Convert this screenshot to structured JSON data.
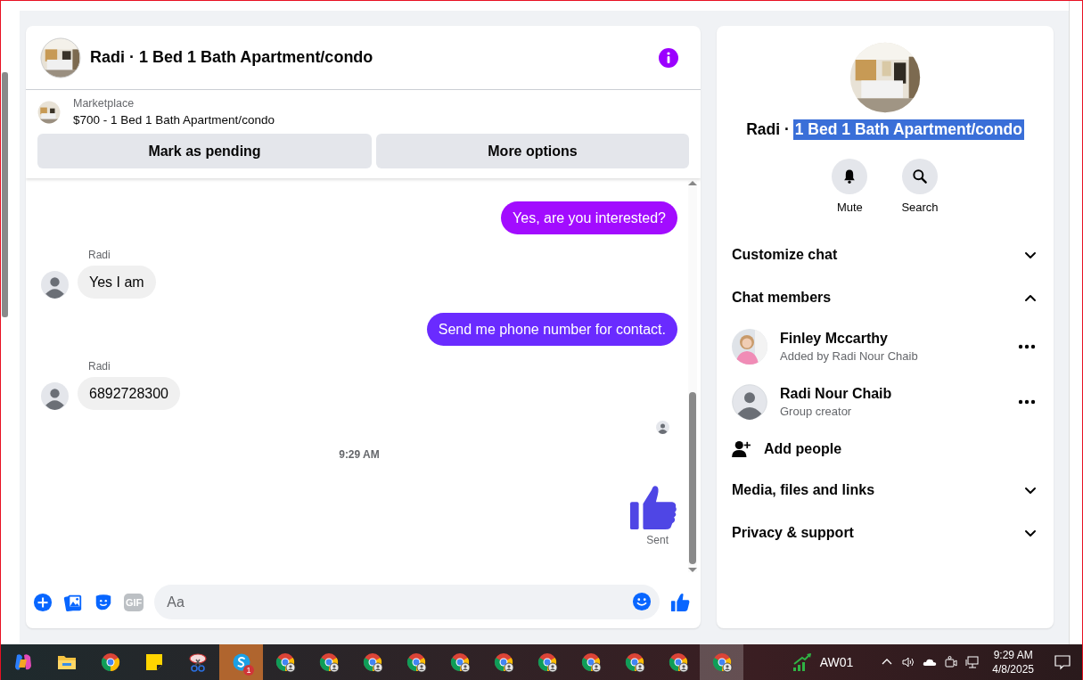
{
  "chat": {
    "title": "Radi · 1 Bed 1 Bath Apartment/condo",
    "listing": {
      "source": "Marketplace",
      "title": "$700 - 1 Bed 1 Bath Apartment/condo"
    },
    "actions": [
      "Mark as pending",
      "More options"
    ],
    "messages": [
      {
        "kind": "outgoing",
        "text": "Yes, are you interested?",
        "color": "#a20cff"
      },
      {
        "kind": "incoming",
        "sender": "Radi",
        "text": "Yes I am"
      },
      {
        "kind": "outgoing",
        "text": "Send me phone number for contact.",
        "color": "#6a2bff"
      },
      {
        "kind": "incoming",
        "sender": "Radi",
        "text": "6892728300"
      },
      {
        "kind": "seen"
      },
      {
        "kind": "timestamp",
        "text": "9:29 AM"
      },
      {
        "kind": "like",
        "status": "Sent"
      }
    ],
    "composer": {
      "gif": "GIF",
      "placeholder": "Aa"
    }
  },
  "info": {
    "title_parts": [
      {
        "text": "Radi ·",
        "selected": false
      },
      {
        "text": "1 Bed 1 Bath Apartment/condo",
        "selected": true
      }
    ],
    "quick_actions": [
      {
        "kind": "mute",
        "label": "Mute"
      },
      {
        "kind": "search",
        "label": "Search"
      }
    ],
    "sections": [
      {
        "kind": "section",
        "label": "Customize chat",
        "expanded": false
      },
      {
        "kind": "section",
        "label": "Chat members",
        "expanded": true
      },
      {
        "kind": "member",
        "has_photo": true,
        "name": "Finley Mccarthy",
        "role": "Added by Radi Nour Chaib"
      },
      {
        "kind": "member",
        "has_photo": false,
        "name": "Radi Nour Chaib",
        "role": "Group creator"
      },
      {
        "kind": "add",
        "label": "Add people"
      },
      {
        "kind": "section",
        "label": "Media, files and links",
        "expanded": false
      },
      {
        "kind": "section",
        "label": "Privacy & support",
        "expanded": false
      }
    ]
  },
  "taskbar": {
    "apps": [
      {
        "kind": "copilot",
        "selected": false,
        "attention": false
      },
      {
        "kind": "folder",
        "selected": false,
        "attention": false
      },
      {
        "kind": "chrome",
        "selected": false,
        "attention": false
      },
      {
        "kind": "notes",
        "selected": false,
        "attention": false
      },
      {
        "kind": "snip",
        "selected": false,
        "attention": false
      },
      {
        "kind": "skype",
        "selected": false,
        "attention": true,
        "badge": "1"
      },
      {
        "kind": "chrome-profile",
        "selected": false,
        "attention": false
      },
      {
        "kind": "chrome-profile",
        "selected": false,
        "attention": false
      },
      {
        "kind": "chrome-profile",
        "selected": false,
        "attention": false
      },
      {
        "kind": "chrome-profile",
        "selected": false,
        "attention": false
      },
      {
        "kind": "chrome-profile",
        "selected": false,
        "attention": false
      },
      {
        "kind": "chrome-profile",
        "selected": false,
        "attention": false
      },
      {
        "kind": "chrome-profile",
        "selected": false,
        "attention": false
      },
      {
        "kind": "chrome-profile",
        "selected": false,
        "attention": false
      },
      {
        "kind": "chrome-profile",
        "selected": false,
        "attention": false
      },
      {
        "kind": "chrome-profile",
        "selected": false,
        "attention": false
      },
      {
        "kind": "chrome-profile",
        "selected": true,
        "attention": false
      }
    ],
    "stock": "AW01",
    "time": "9:29 AM",
    "date": "4/8/2025"
  }
}
